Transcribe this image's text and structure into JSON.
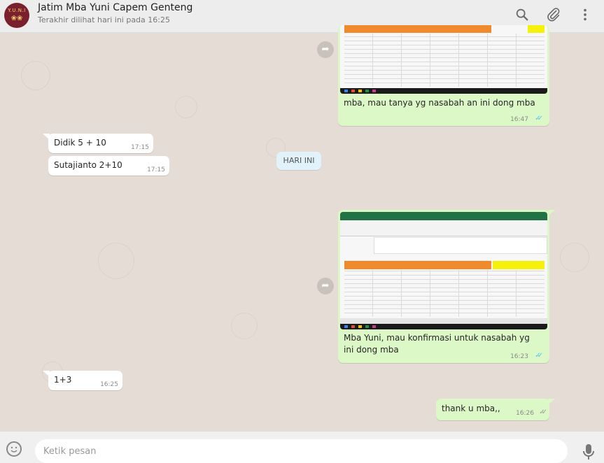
{
  "header": {
    "avatar_line1": "Y.U.N.I",
    "avatar_line2": "❀❀",
    "title": "Jatim Mba Yuni Capem Genteng",
    "subtitle": "Terakhir dilihat hari ini pada 16:25",
    "icons": [
      "search-icon",
      "attach-icon",
      "menu-icon"
    ]
  },
  "messages": [
    {
      "type": "out",
      "text": "mba, mau tanya yg nasabah an ini dong mba",
      "time": "16:47",
      "status": "read",
      "attachment": "screenshot"
    },
    {
      "type": "in",
      "text": "Didik 5 + 10",
      "time": "17:15"
    },
    {
      "type": "in",
      "text": "Sutajianto 2+10",
      "time": "17:15"
    },
    {
      "type": "out",
      "text": "Mba Yuni, mau konfirmasi untuk nasabah yg ini dong mba",
      "time": "16:23",
      "status": "read",
      "attachment": "screenshot"
    },
    {
      "type": "in",
      "text": "1+3",
      "time": "16:25"
    },
    {
      "type": "out",
      "text": "thank u mba,,",
      "time": "16:26",
      "status": "delivered"
    }
  ],
  "day_divider": "HARI INI",
  "composer": {
    "placeholder": "Ketik pesan",
    "icons": [
      "emoji-icon",
      "microphone-icon"
    ]
  },
  "colors": {
    "outgoing_bubble": "#dcf8c6",
    "incoming_bubble": "#ffffff",
    "read_ticks": "#4fc3f7",
    "chat_background": "#e5ddd5"
  }
}
